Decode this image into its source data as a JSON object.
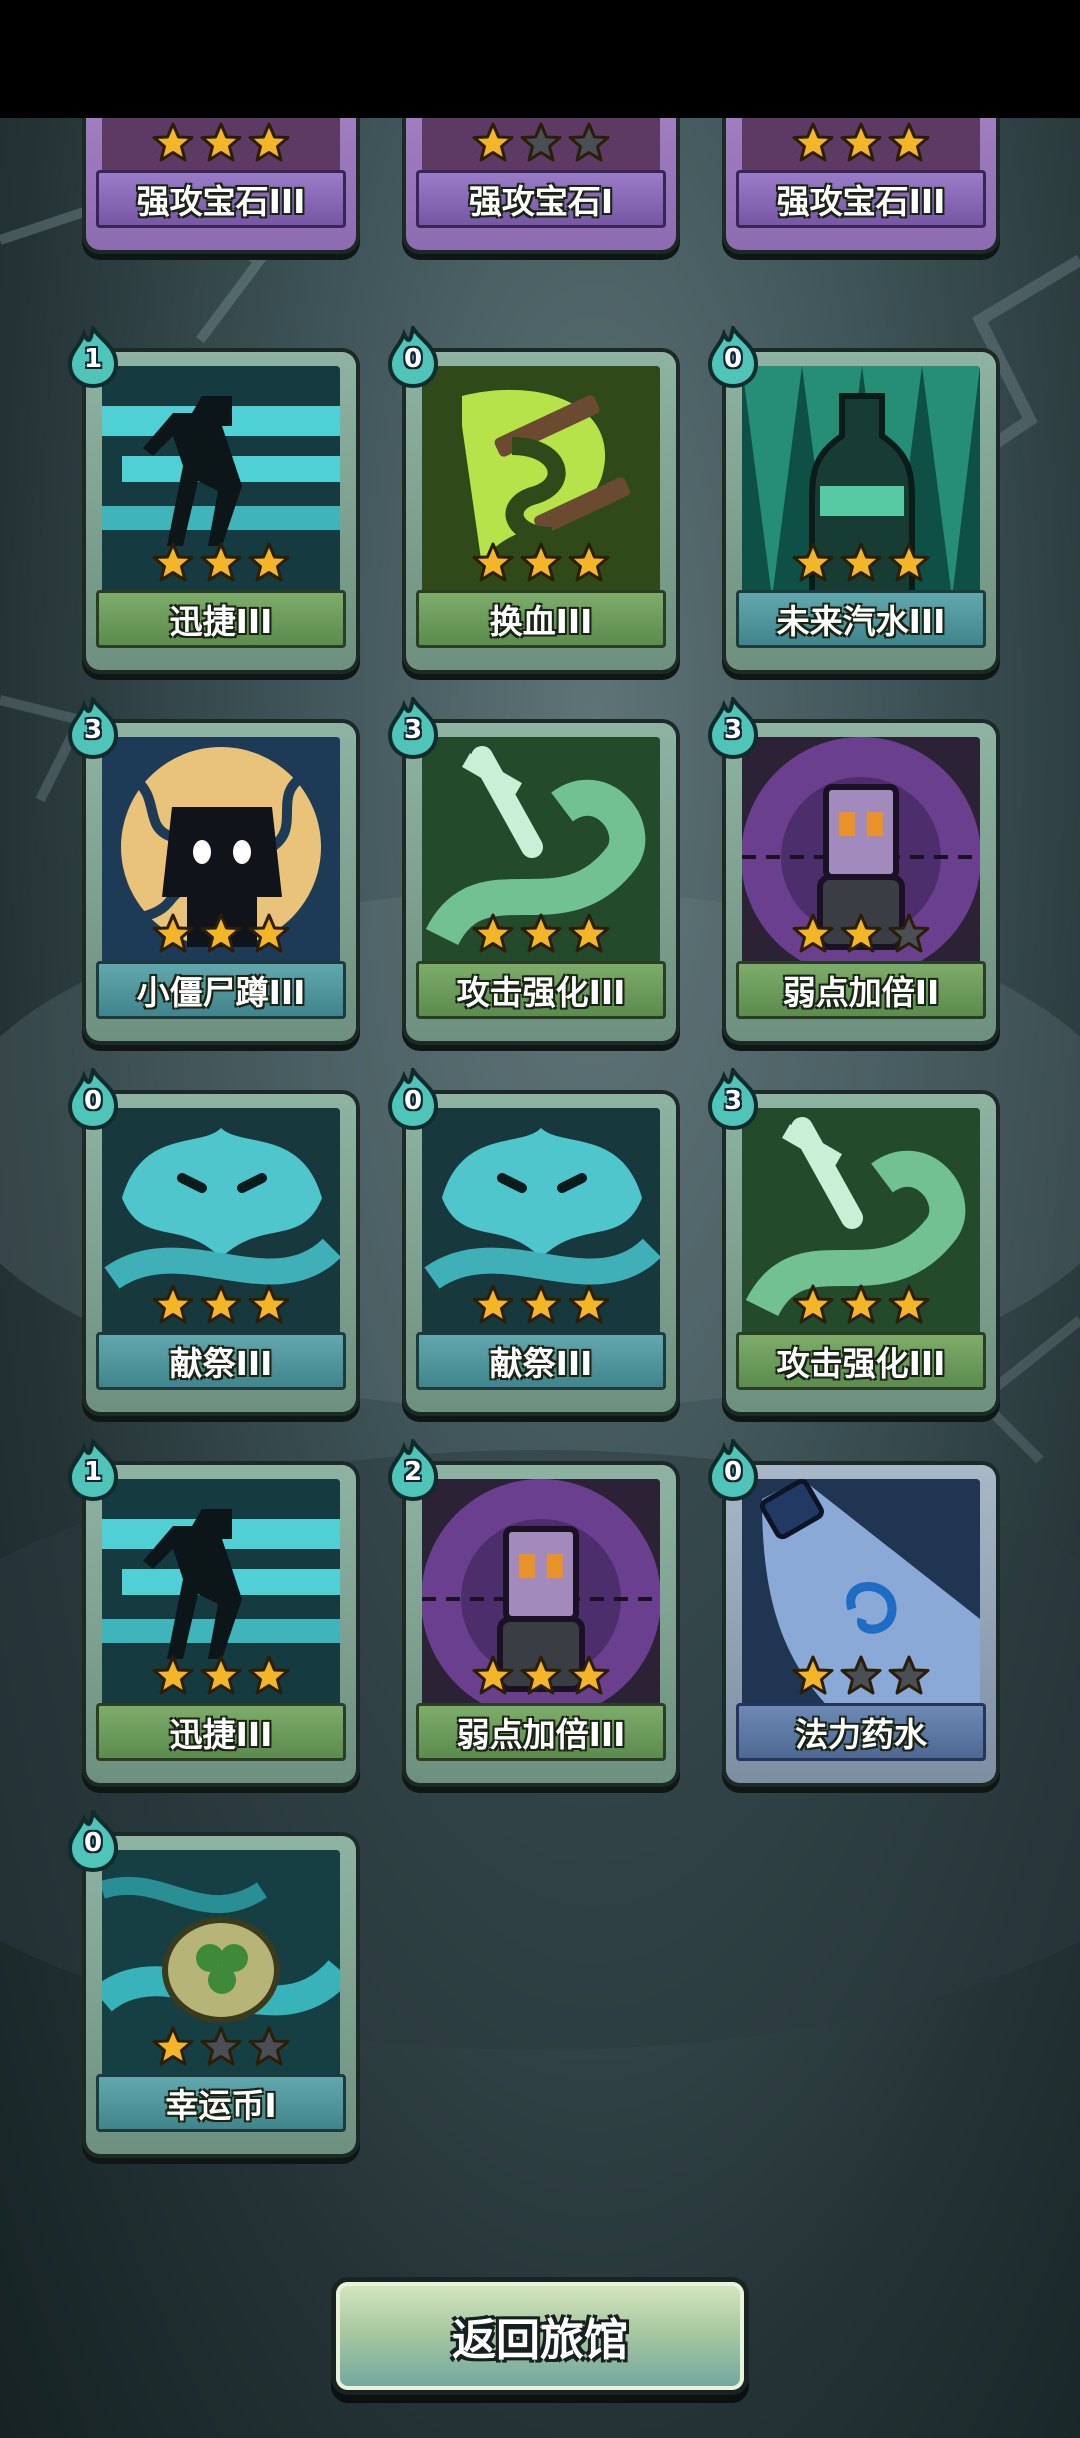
{
  "cards": [
    {
      "name": "强攻宝石III",
      "stars": 3,
      "cost": null,
      "theme": "purple",
      "art": "gem"
    },
    {
      "name": "强攻宝石I",
      "stars": 1,
      "cost": null,
      "theme": "purple",
      "art": "gem"
    },
    {
      "name": "强攻宝石III",
      "stars": 3,
      "cost": null,
      "theme": "purple",
      "art": "gem"
    },
    {
      "name": "迅捷III",
      "stars": 3,
      "cost": "1",
      "theme": "green",
      "art": "runner"
    },
    {
      "name": "换血III",
      "stars": 3,
      "cost": "0",
      "theme": "green",
      "art": "blood-swap"
    },
    {
      "name": "未来汽水III",
      "stars": 3,
      "cost": "0",
      "theme": "teal",
      "art": "soda"
    },
    {
      "name": "小僵尸蹲III",
      "stars": 3,
      "cost": "3",
      "theme": "teal",
      "art": "zombie"
    },
    {
      "name": "攻击强化III",
      "stars": 3,
      "cost": "3",
      "theme": "green",
      "art": "sword-swirl"
    },
    {
      "name": "弱点加倍II",
      "stars": 2,
      "cost": "3",
      "theme": "green",
      "art": "weak-point"
    },
    {
      "name": "献祭III",
      "stars": 3,
      "cost": "0",
      "theme": "teal",
      "art": "sacrifice"
    },
    {
      "name": "献祭III",
      "stars": 3,
      "cost": "0",
      "theme": "teal",
      "art": "sacrifice"
    },
    {
      "name": "攻击强化III",
      "stars": 3,
      "cost": "3",
      "theme": "green",
      "art": "sword-swirl"
    },
    {
      "name": "迅捷III",
      "stars": 3,
      "cost": "1",
      "theme": "green",
      "art": "runner"
    },
    {
      "name": "弱点加倍III",
      "stars": 3,
      "cost": "2",
      "theme": "green",
      "art": "weak-point"
    },
    {
      "name": "法力药水",
      "stars": 1,
      "cost": "0",
      "theme": "blue",
      "art": "mana-potion"
    },
    {
      "name": "幸运币I",
      "stars": 1,
      "cost": "0",
      "theme": "teal",
      "art": "lucky-coin"
    }
  ],
  "button": {
    "back_label": "返回旅馆"
  },
  "colors": {
    "star_gold": "#f4b526",
    "star_gray": "#4a4f55",
    "cost_badge": "#4fc4b8"
  }
}
